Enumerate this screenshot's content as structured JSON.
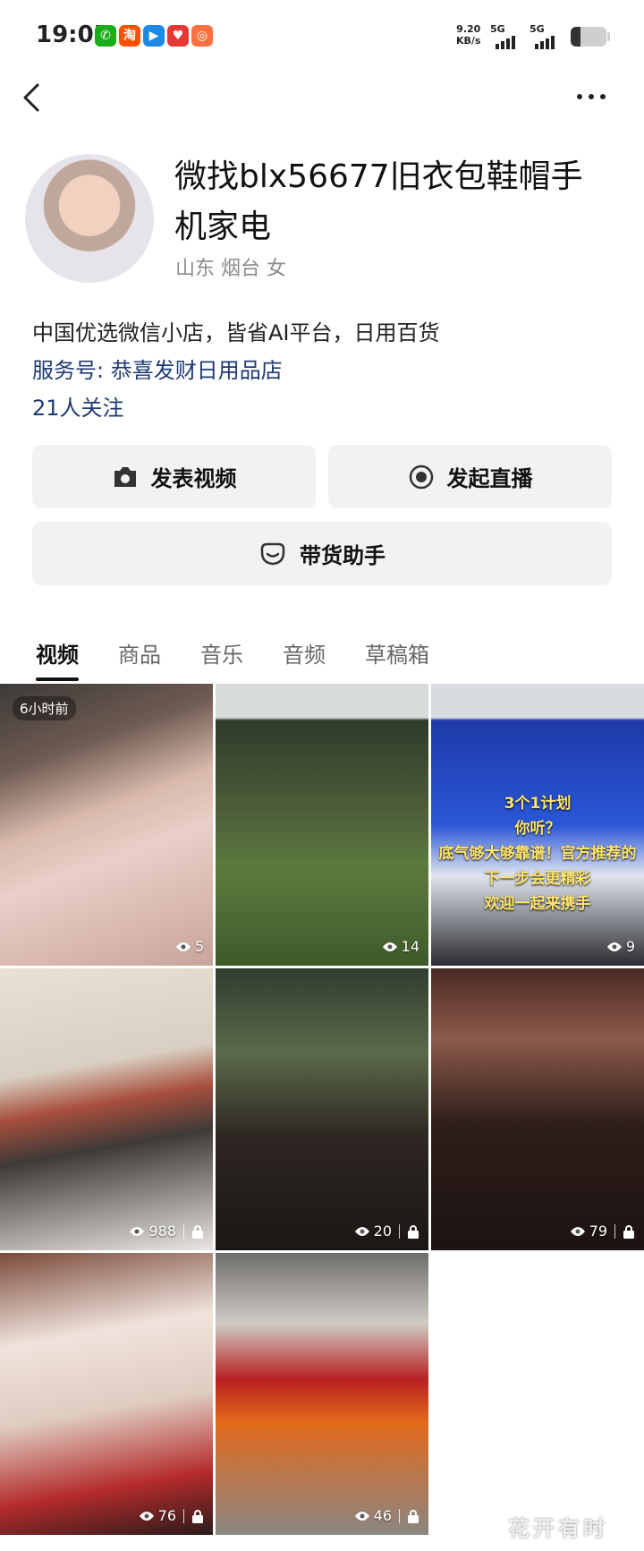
{
  "status_bar": {
    "time": "19:05",
    "net_speed_value": "9.20",
    "net_speed_unit": "KB/s",
    "signal1": "5G",
    "signal2": "5G",
    "notification_icons": [
      {
        "name": "wechat-icon",
        "glyph": "✆",
        "color": "#1aad19"
      },
      {
        "name": "taobao-icon",
        "glyph": "淘",
        "color": "#ff5000"
      },
      {
        "name": "browser-icon",
        "glyph": "▶",
        "color": "#1e88e5"
      },
      {
        "name": "heart-app-icon",
        "glyph": "♥",
        "color": "#e53935"
      },
      {
        "name": "grid-app-icon",
        "glyph": "◎",
        "color": "#ff7043"
      }
    ]
  },
  "profile": {
    "nickname": "微找blx56677旧衣包鞋帽手机家电",
    "location": "山东 烟台 女",
    "bio": "中国优选微信小店，皆省AI平台，日用百货",
    "service": "服务号: 恭喜发财日用品店",
    "followers": "21人关注"
  },
  "actions": {
    "post_video": "发表视频",
    "start_live": "发起直播",
    "sales_helper": "带货助手"
  },
  "tabs": [
    {
      "label": "视频",
      "active": true
    },
    {
      "label": "商品",
      "active": false
    },
    {
      "label": "音乐",
      "active": false
    },
    {
      "label": "音频",
      "active": false
    },
    {
      "label": "草稿箱",
      "active": false
    }
  ],
  "videos": [
    {
      "views": "5",
      "locked": false,
      "badge": "6小时前"
    },
    {
      "views": "14",
      "locked": false
    },
    {
      "views": "9",
      "locked": false,
      "overlay": [
        "3个1计划",
        "你听？",
        "底气够大够靠谱！官方推荐的",
        "下一步会更精彩",
        "欢迎一起来携手"
      ]
    },
    {
      "views": "988",
      "locked": true
    },
    {
      "views": "20",
      "locked": true
    },
    {
      "views": "79",
      "locked": true
    },
    {
      "views": "76",
      "locked": true
    },
    {
      "views": "46",
      "locked": true
    }
  ],
  "watermark": "花开有时"
}
